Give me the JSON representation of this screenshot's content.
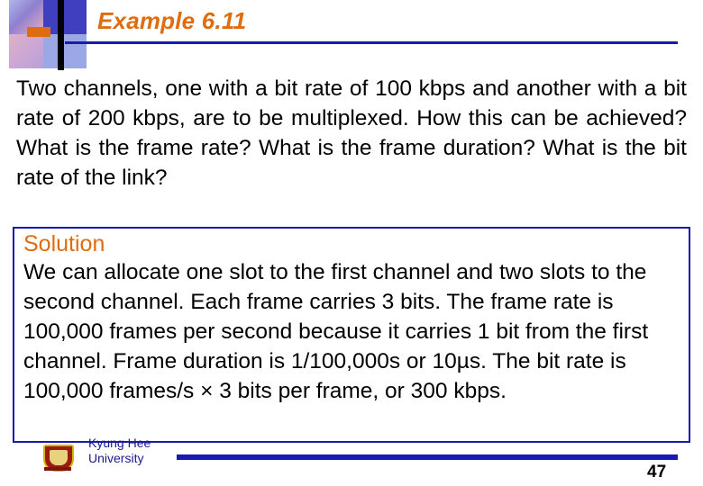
{
  "slide": {
    "title": "Example 6.11",
    "question": "Two channels, one with a bit rate of 100 kbps and another with a bit rate of 200 kbps, are to be multiplexed. How this can be achieved? What is the frame rate? What is the frame duration? What is the bit rate of the link?",
    "solution_label": "Solution",
    "solution_text": "We can allocate one slot to the first channel and two slots to the second channel. Each frame carries 3 bits. The frame rate is 100,000 frames per second because it carries 1 bit from the first channel. Frame duration is 1/100,000s or 10µs. The bit rate is 100,000 frames/s × 3 bits per frame, or 300 kbps.",
    "footer": {
      "organization_line1": "Kyung Hee",
      "organization_line2": "University",
      "page_number": "47"
    },
    "colors": {
      "title": "#e06c10",
      "rule": "#1a1ab0",
      "solution_label": "#e06c10",
      "box_border": "#1a1ab0",
      "footer_text": "#1a1a8f"
    }
  }
}
